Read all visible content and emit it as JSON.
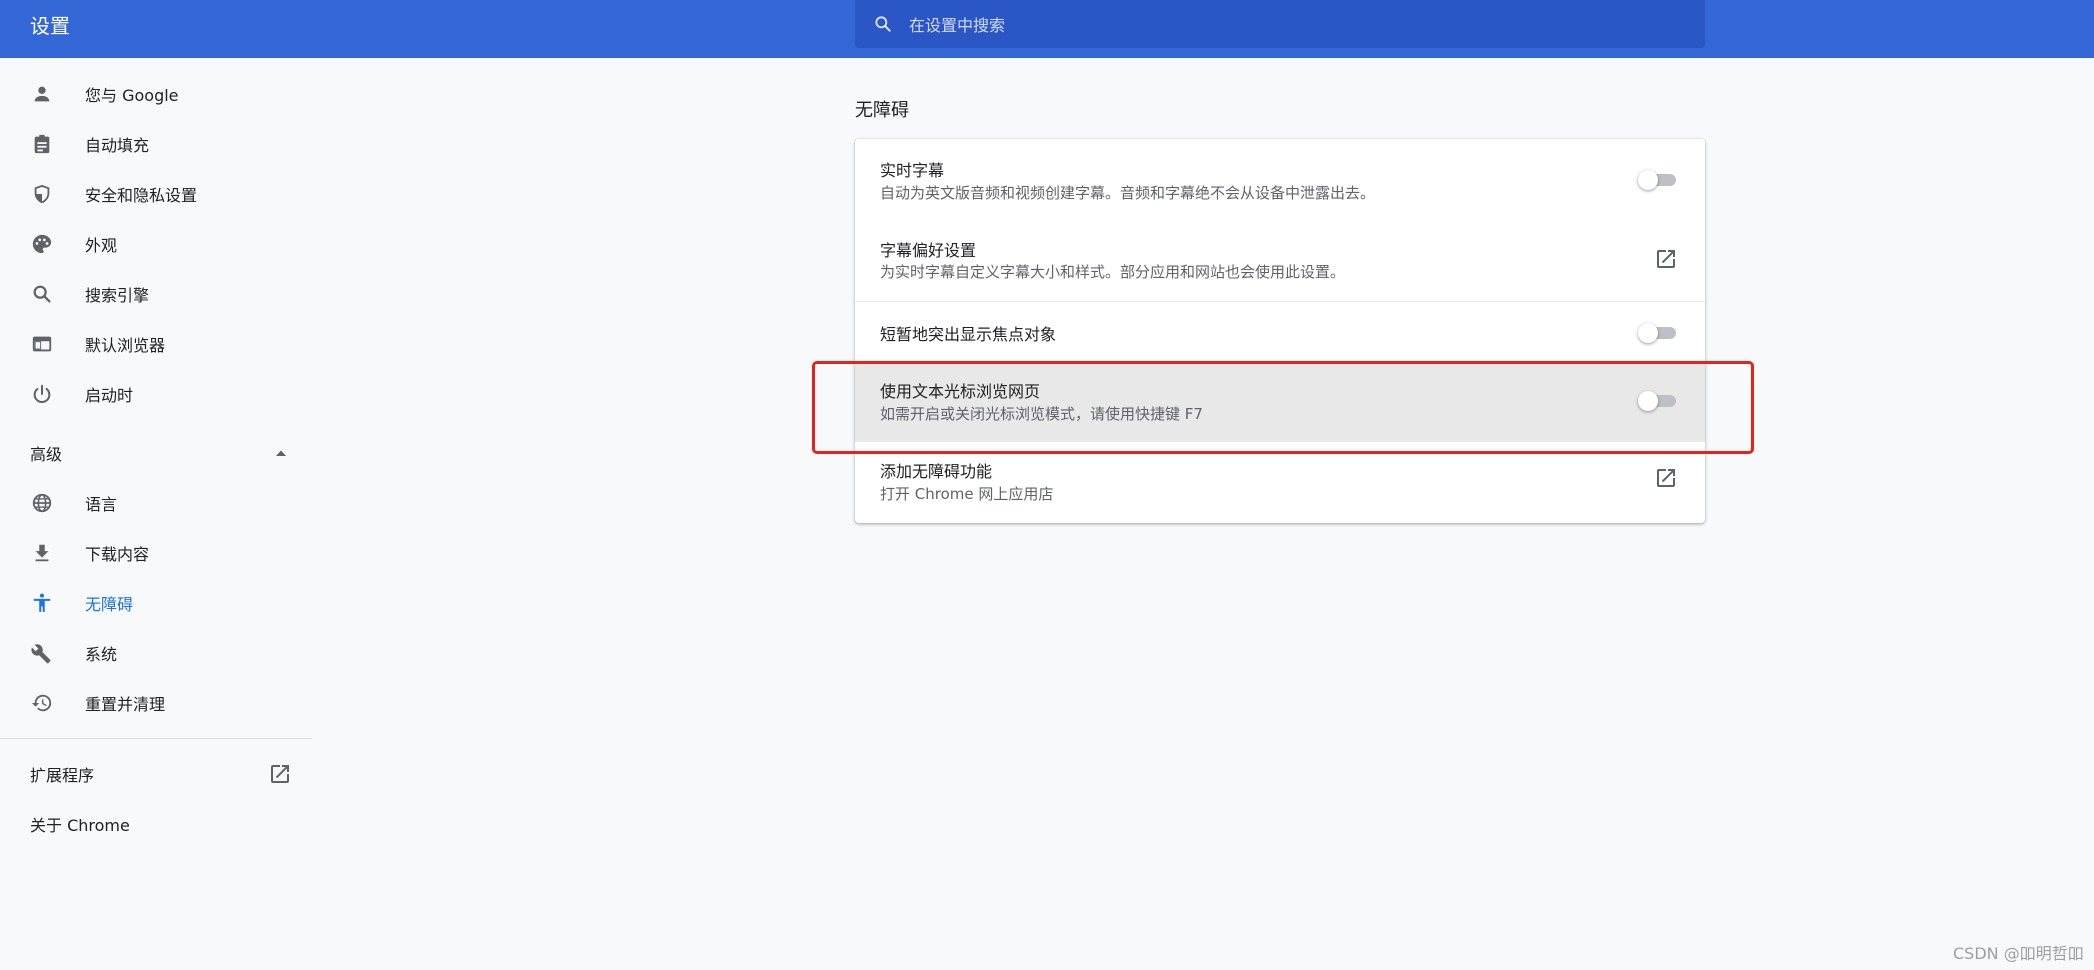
{
  "header": {
    "title": "设置",
    "search_placeholder": "在设置中搜索"
  },
  "sidebar": {
    "items": [
      {
        "label": "您与 Google",
        "icon": "person-icon"
      },
      {
        "label": "自动填充",
        "icon": "clipboard-icon"
      },
      {
        "label": "安全和隐私设置",
        "icon": "shield-icon"
      },
      {
        "label": "外观",
        "icon": "palette-icon"
      },
      {
        "label": "搜索引擎",
        "icon": "search-icon"
      },
      {
        "label": "默认浏览器",
        "icon": "browser-icon"
      },
      {
        "label": "启动时",
        "icon": "power-icon"
      }
    ],
    "advanced_label": "高级",
    "advanced_items": [
      {
        "label": "语言",
        "icon": "globe-icon"
      },
      {
        "label": "下载内容",
        "icon": "download-icon"
      },
      {
        "label": "无障碍",
        "icon": "accessibility-icon",
        "active": true
      },
      {
        "label": "系统",
        "icon": "wrench-icon"
      },
      {
        "label": "重置并清理",
        "icon": "restore-icon"
      }
    ],
    "extensions_label": "扩展程序",
    "about_label": "关于 Chrome"
  },
  "main": {
    "section_title": "无障碍",
    "rows": [
      {
        "title": "实时字幕",
        "subtitle": "自动为英文版音频和视频创建字幕。音频和字幕绝不会从设备中泄露出去。",
        "control": "toggle",
        "enabled": false
      },
      {
        "title": "字幕偏好设置",
        "subtitle": "为实时字幕自定义字幕大小和样式。部分应用和网站也会使用此设置。",
        "control": "launch"
      },
      {
        "title": "短暂地突出显示焦点对象",
        "subtitle": "",
        "control": "toggle",
        "enabled": false
      },
      {
        "title": "使用文本光标浏览网页",
        "subtitle": "如需开启或关闭光标浏览模式，请使用快捷键 F7",
        "control": "toggle",
        "enabled": false,
        "highlighted": true
      },
      {
        "title": "添加无障碍功能",
        "subtitle": "打开 Chrome 网上应用店",
        "control": "launch"
      }
    ]
  },
  "watermark": "CSDN @吅明哲吅",
  "colors": {
    "header": "#3367d6",
    "search": "#2a56c6",
    "accent": "#1a73e8",
    "annotation": "#e8211a"
  }
}
